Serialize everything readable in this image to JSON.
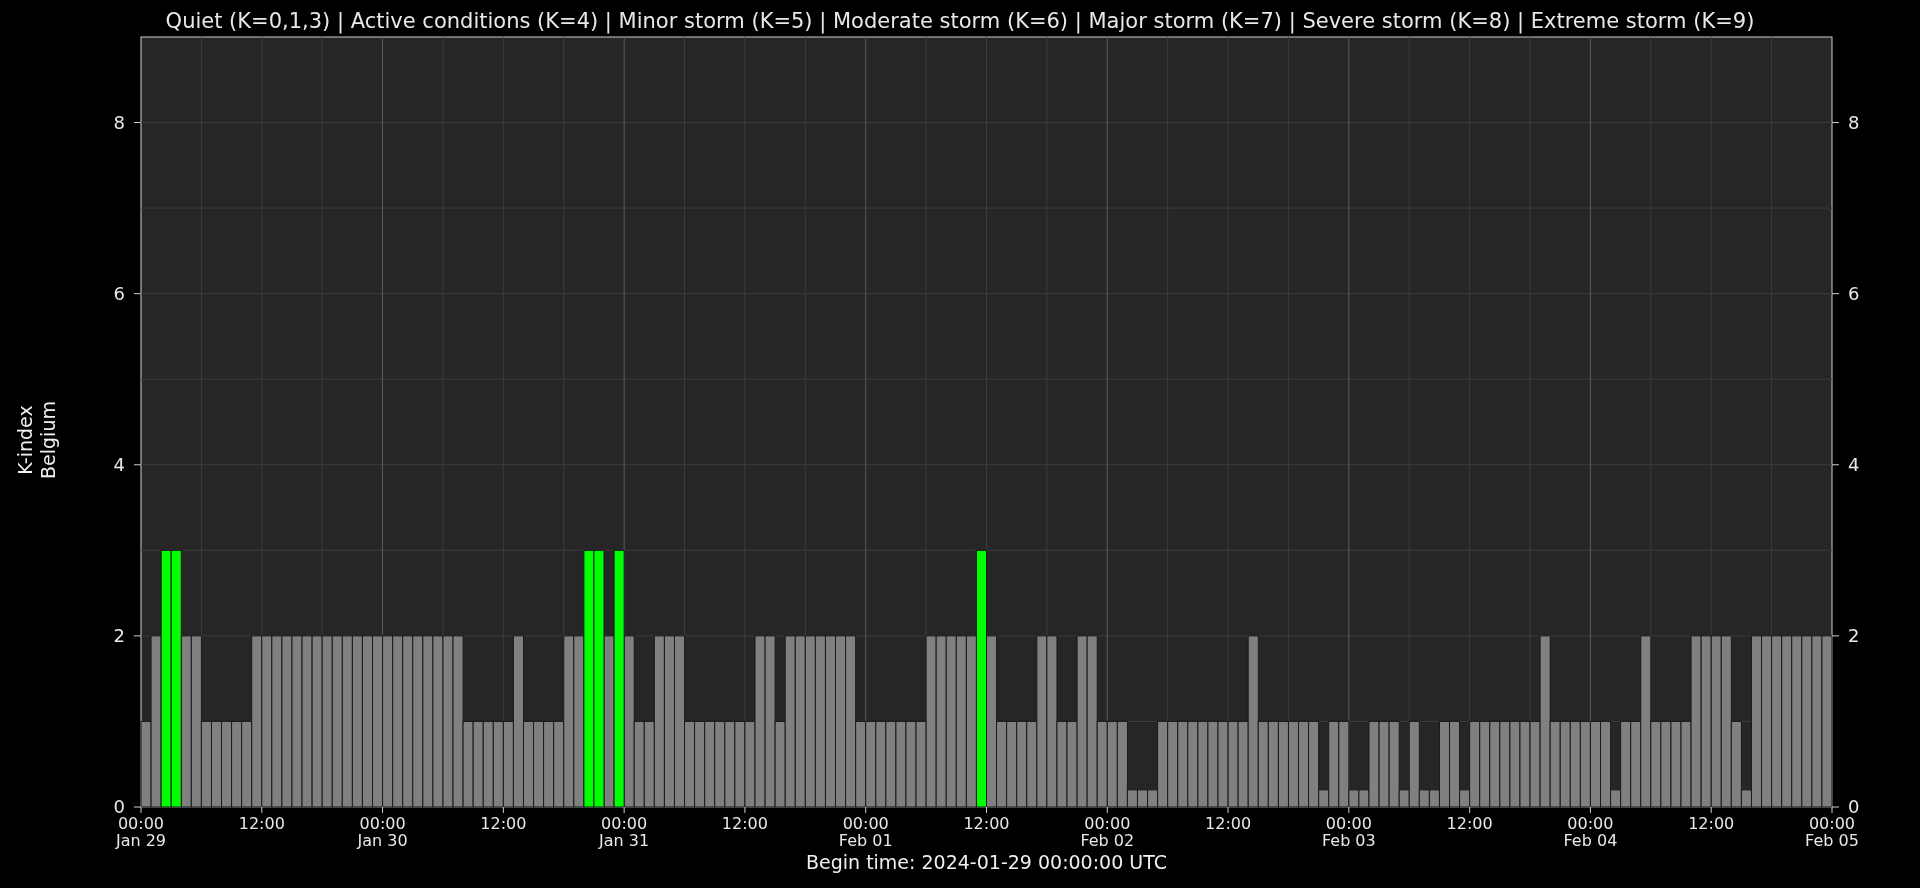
{
  "chart_data": {
    "type": "bar",
    "title": "Quiet (K=0,1,3) | Active conditions (K=4) | Minor storm (K=5) | Moderate storm (K=6) | Major storm (K=7) | Severe storm (K=8) | Extreme storm (K=9)",
    "xlabel": "Begin time: 2024-01-29 00:00:00 UTC",
    "ylabel": [
      "K-index",
      "Belgium"
    ],
    "stacked": true,
    "ylim": [
      0,
      9
    ],
    "yticks": [
      0,
      2,
      4,
      6,
      8
    ],
    "grid": true,
    "annotations": [
      "0",
      "2",
      "4",
      "6",
      "8",
      "00:00\nFeb 05"
    ],
    "categories": [
      "00:00\nJan 29",
      null,
      null,
      null,
      null,
      null,
      null,
      null,
      null,
      null,
      null,
      null,
      "12:00",
      null,
      null,
      null,
      null,
      null,
      null,
      null,
      null,
      null,
      null,
      null,
      "00:00\nJan 30",
      null,
      null,
      null,
      null,
      null,
      null,
      null,
      null,
      null,
      null,
      null,
      "12:00",
      null,
      null,
      null,
      null,
      null,
      null,
      null,
      null,
      null,
      null,
      null,
      "00:00\nJan 31",
      null,
      null,
      null,
      null,
      null,
      null,
      null,
      null,
      null,
      null,
      null,
      "12:00",
      null,
      null,
      null,
      null,
      null,
      null,
      null,
      null,
      null,
      null,
      null,
      "00:00\nFeb 01",
      null,
      null,
      null,
      null,
      null,
      null,
      null,
      null,
      null,
      null,
      null,
      "12:00",
      null,
      null,
      null,
      null,
      null,
      null,
      null,
      null,
      null,
      null,
      null,
      "00:00\nFeb 02",
      null,
      null,
      null,
      null,
      null,
      null,
      null,
      null,
      null,
      null,
      null,
      "12:00",
      null,
      null,
      null,
      null,
      null,
      null,
      null,
      null,
      null,
      null,
      null,
      "00:00\nFeb 03",
      null,
      null,
      null,
      null,
      null,
      null,
      null,
      null,
      null,
      null,
      null,
      "12:00",
      null,
      null,
      null,
      null,
      null,
      null,
      null,
      null,
      null,
      null,
      null,
      "00:00\nFeb 04",
      null,
      null,
      null,
      null,
      null,
      null,
      null,
      null,
      null,
      null,
      null,
      "12:00",
      null,
      null,
      null,
      null,
      null,
      null,
      null,
      null,
      null,
      null,
      null
    ],
    "series": [
      {
        "color": "#808080",
        "values": [
          1,
          2,
          null,
          null,
          2,
          2,
          1,
          1,
          1,
          1,
          1,
          2,
          2,
          2,
          2,
          2,
          2,
          2,
          2,
          2,
          2,
          2,
          2,
          2,
          2,
          2,
          2,
          2,
          2,
          2,
          2,
          2,
          1,
          1,
          1,
          1,
          1,
          2,
          1,
          1,
          1,
          1,
          2,
          2,
          null,
          null,
          2,
          null,
          2,
          1,
          1,
          2,
          2,
          2,
          1,
          1,
          1,
          1,
          1,
          1,
          1,
          2,
          2,
          1,
          2,
          2,
          2,
          2,
          2,
          2,
          2,
          1,
          1,
          1,
          1,
          1,
          1,
          1,
          2,
          2,
          2,
          2,
          2,
          null,
          2,
          1,
          1,
          1,
          1,
          2,
          2,
          1,
          1,
          2,
          2,
          1,
          1,
          1,
          0.2,
          0.2,
          0.2,
          1,
          1,
          1,
          1,
          1,
          1,
          1,
          1,
          1,
          2,
          1,
          1,
          1,
          1,
          1,
          1,
          0.2,
          1,
          1,
          0.2,
          0.2,
          1,
          1,
          1,
          0.2,
          1,
          0.2,
          0.2,
          1,
          1,
          0.2,
          1,
          1,
          1,
          1,
          1,
          1,
          1,
          2,
          1,
          1,
          1,
          1,
          1,
          1,
          0.2,
          1,
          1,
          2,
          1,
          1,
          1,
          1,
          2,
          2,
          2,
          2,
          1,
          0.2,
          2,
          2,
          2,
          2,
          2,
          2,
          2,
          2
        ]
      },
      {
        "color": "#00ff00",
        "values": [
          null,
          null,
          3,
          3,
          null,
          null,
          null,
          null,
          null,
          null,
          null,
          null,
          null,
          null,
          null,
          null,
          null,
          null,
          null,
          null,
          null,
          null,
          null,
          null,
          null,
          null,
          null,
          null,
          null,
          null,
          null,
          null,
          null,
          null,
          null,
          null,
          null,
          null,
          null,
          null,
          null,
          null,
          null,
          null,
          3,
          3,
          null,
          3,
          null,
          null,
          null,
          null,
          null,
          null,
          null,
          null,
          null,
          null,
          null,
          null,
          null,
          null,
          null,
          null,
          null,
          null,
          null,
          null,
          null,
          null,
          null,
          null,
          null,
          null,
          null,
          null,
          null,
          null,
          null,
          null,
          null,
          null,
          null,
          3,
          null,
          null,
          null,
          null,
          null,
          null,
          null,
          null,
          null,
          null,
          null,
          null,
          null,
          null,
          null,
          null,
          null,
          null,
          null,
          null,
          null,
          null,
          null,
          null,
          null,
          null,
          null,
          null,
          null,
          null,
          null,
          null,
          null,
          null,
          null,
          null,
          null,
          null,
          null,
          null,
          null,
          null,
          null,
          null,
          null,
          null,
          null,
          null,
          null,
          null,
          null,
          null,
          null,
          null,
          null,
          null,
          null,
          null,
          null,
          null,
          null,
          null,
          null,
          null,
          null,
          null,
          null,
          null,
          null,
          null,
          null,
          null,
          null,
          null,
          null,
          null,
          null,
          null,
          null,
          null,
          null,
          null,
          null,
          null
        ]
      }
    ]
  }
}
